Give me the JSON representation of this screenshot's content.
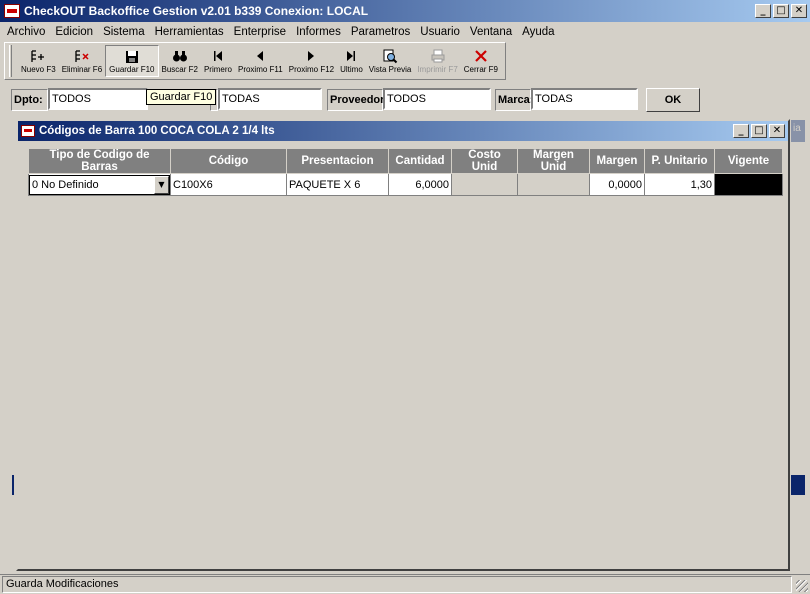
{
  "window": {
    "title": "CheckOUT Backoffice Gestion v2.01 b339 Conexion: LOCAL",
    "controls": [
      "_",
      "□",
      "✕"
    ]
  },
  "menu": [
    "Archivo",
    "Edicion",
    "Sistema",
    "Herramientas",
    "Enterprise",
    "Informes",
    "Parametros",
    "Usuario",
    "Ventana",
    "Ayuda"
  ],
  "toolbar": {
    "buttons": [
      {
        "label": "Nuevo F3",
        "icon": "new-icon",
        "glyph": "☰"
      },
      {
        "label": "Eliminar F6",
        "icon": "delete-icon",
        "glyph": "☰"
      },
      {
        "label": "Guardar F10",
        "icon": "save-icon",
        "glyph": "💾"
      },
      {
        "label": "Buscar F2",
        "icon": "binoculars-icon",
        "glyph": "⚲"
      },
      {
        "label": "Primero",
        "icon": "first-icon",
        "glyph": "⏮"
      },
      {
        "label": "Proximo F11",
        "icon": "prev-icon",
        "glyph": "◀"
      },
      {
        "label": "Proximo F12",
        "icon": "next-icon",
        "glyph": "▶"
      },
      {
        "label": "Ultimo",
        "icon": "last-icon",
        "glyph": "⏭"
      },
      {
        "label": "Vista Previa",
        "icon": "preview-icon",
        "glyph": "🔍"
      },
      {
        "label": "Imprimir F7",
        "icon": "print-icon",
        "glyph": "⎙"
      },
      {
        "label": "Cerrar F9",
        "icon": "close-icon",
        "glyph": "✕"
      }
    ],
    "tooltip": "Guardar F10"
  },
  "filters": {
    "dpto_label": "Dpto:",
    "dpto_value": "TODOS",
    "seccion_label": ":",
    "seccion_value": "TODAS",
    "proveedor_label": "Proveedor:",
    "proveedor_value": "TODOS",
    "marca_label": "Marca:",
    "marca_value": "TODAS",
    "ok_label": "OK"
  },
  "child_window": {
    "title": "Códigos de Barra 100 COCA COLA 2 1/4 lts",
    "side_label": "ia"
  },
  "grid": {
    "headers": [
      "Tipo de Codigo de Barras",
      "Código",
      "Presentacion",
      "Cantidad",
      "Costo Unid",
      "Margen Unid",
      "Margen",
      "P. Unitario",
      "Vigente"
    ],
    "row": {
      "tipo": "0 No Definido",
      "codigo": "C100X6",
      "presentacion": "PAQUETE X 6",
      "cantidad": "6,0000",
      "costo_unid": "",
      "margen_unid": "",
      "margen": "0,0000",
      "p_unitario": "1,30",
      "vigente": ""
    }
  },
  "status": {
    "text": "Guarda Modificaciones"
  },
  "colors": {
    "titlebar": "#0a246a",
    "header": "#808080",
    "face": "#d4d0c8",
    "close_red": "#cc0000"
  }
}
